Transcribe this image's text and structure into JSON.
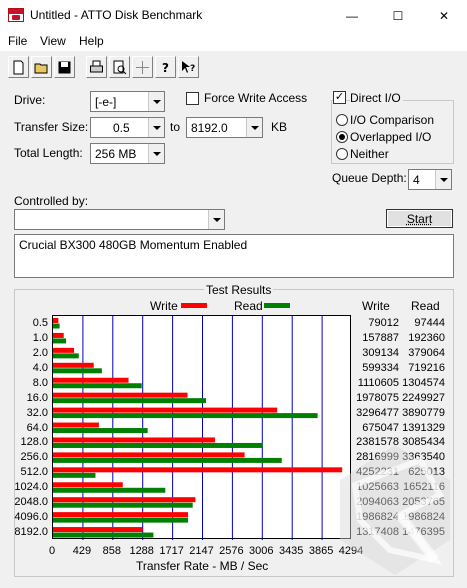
{
  "window": {
    "title": "Untitled - ATTO Disk Benchmark",
    "minimize": "—",
    "maximize": "☐",
    "close": "✕"
  },
  "menu": [
    "File",
    "View",
    "Help"
  ],
  "toolbar": [
    "new-icon",
    "open-icon",
    "save-icon",
    "print-icon",
    "print-preview-icon",
    "move-icon",
    "help-icon",
    "context-help-icon"
  ],
  "form": {
    "drive_label": "Drive:",
    "drive_value": "[-e-]",
    "force_write_label": "Force Write Access",
    "force_write_checked": false,
    "direct_io_label": "Direct I/O",
    "direct_io_checked": true,
    "transfer_size_label": "Transfer Size:",
    "transfer_from": "0.5",
    "transfer_to_label": "to",
    "transfer_to": "8192.0",
    "transfer_unit": "KB",
    "total_length_label": "Total Length:",
    "total_length": "256 MB",
    "io_options": [
      "I/O Comparison",
      "Overlapped I/O",
      "Neither"
    ],
    "io_selected": "Overlapped I/O",
    "queue_depth_label": "Queue Depth:",
    "queue_depth": "4",
    "controlled_by_label": "Controlled by:",
    "controlled_by_value": "",
    "start_label": "Start",
    "description": "Crucial BX300 480GB Momentum Enabled"
  },
  "results": {
    "title": "Test Results",
    "legend_write": "Write",
    "legend_read": "Read",
    "col_write": "Write",
    "col_read": "Read",
    "rows": [
      {
        "size": "0.5",
        "write": "79012",
        "read": "97444"
      },
      {
        "size": "1.0",
        "write": "157887",
        "read": "192360"
      },
      {
        "size": "2.0",
        "write": "309134",
        "read": "379064"
      },
      {
        "size": "4.0",
        "write": "599334",
        "read": "719216"
      },
      {
        "size": "8.0",
        "write": "1110605",
        "read": "1304574"
      },
      {
        "size": "16.0",
        "write": "1978075",
        "read": "2249927"
      },
      {
        "size": "32.0",
        "write": "3296477",
        "read": "3890779"
      },
      {
        "size": "64.0",
        "write": "675047",
        "read": "1391329"
      },
      {
        "size": "128.0",
        "write": "2381578",
        "read": "3085434"
      },
      {
        "size": "256.0",
        "write": "2816999",
        "read": "3363540"
      },
      {
        "size": "512.0",
        "write": "4252231",
        "read": "625013"
      },
      {
        "size": "1024.0",
        "write": "1025663",
        "read": "1652116"
      },
      {
        "size": "2048.0",
        "write": "2094063",
        "read": "2053765"
      },
      {
        "size": "4096.0",
        "write": "1986824",
        "read": "1986824"
      },
      {
        "size": "8192.0",
        "write": "1317408",
        "read": "1476395"
      }
    ],
    "xaxis_label": "Transfer Rate - MB / Sec"
  },
  "chart_data": {
    "type": "bar",
    "orientation": "horizontal",
    "title": "Test Results",
    "categories": [
      "0.5",
      "1.0",
      "2.0",
      "4.0",
      "8.0",
      "16.0",
      "32.0",
      "64.0",
      "128.0",
      "256.0",
      "512.0",
      "1024.0",
      "2048.0",
      "4096.0",
      "8192.0"
    ],
    "series": [
      {
        "name": "Write",
        "color": "#ff0000",
        "values": [
          77,
          154,
          302,
          585,
          1085,
          1932,
          3219,
          659,
          2326,
          2751,
          4153,
          1002,
          2045,
          1940,
          1287
        ]
      },
      {
        "name": "Read",
        "color": "#008000",
        "values": [
          95,
          188,
          370,
          702,
          1274,
          2197,
          3800,
          1359,
          3013,
          3285,
          610,
          1613,
          2006,
          1940,
          1442
        ]
      }
    ],
    "xticks": [
      "0",
      "429",
      "858",
      "1288",
      "1717",
      "2147",
      "2576",
      "3006",
      "3435",
      "3865",
      "4294"
    ],
    "xlim": [
      0,
      4294
    ],
    "xlabel": "Transfer Rate - MB / Sec",
    "grid": true,
    "legend": "top"
  },
  "colors": {
    "write": "#ff0000",
    "read": "#008000",
    "grid": "#0000c0"
  }
}
